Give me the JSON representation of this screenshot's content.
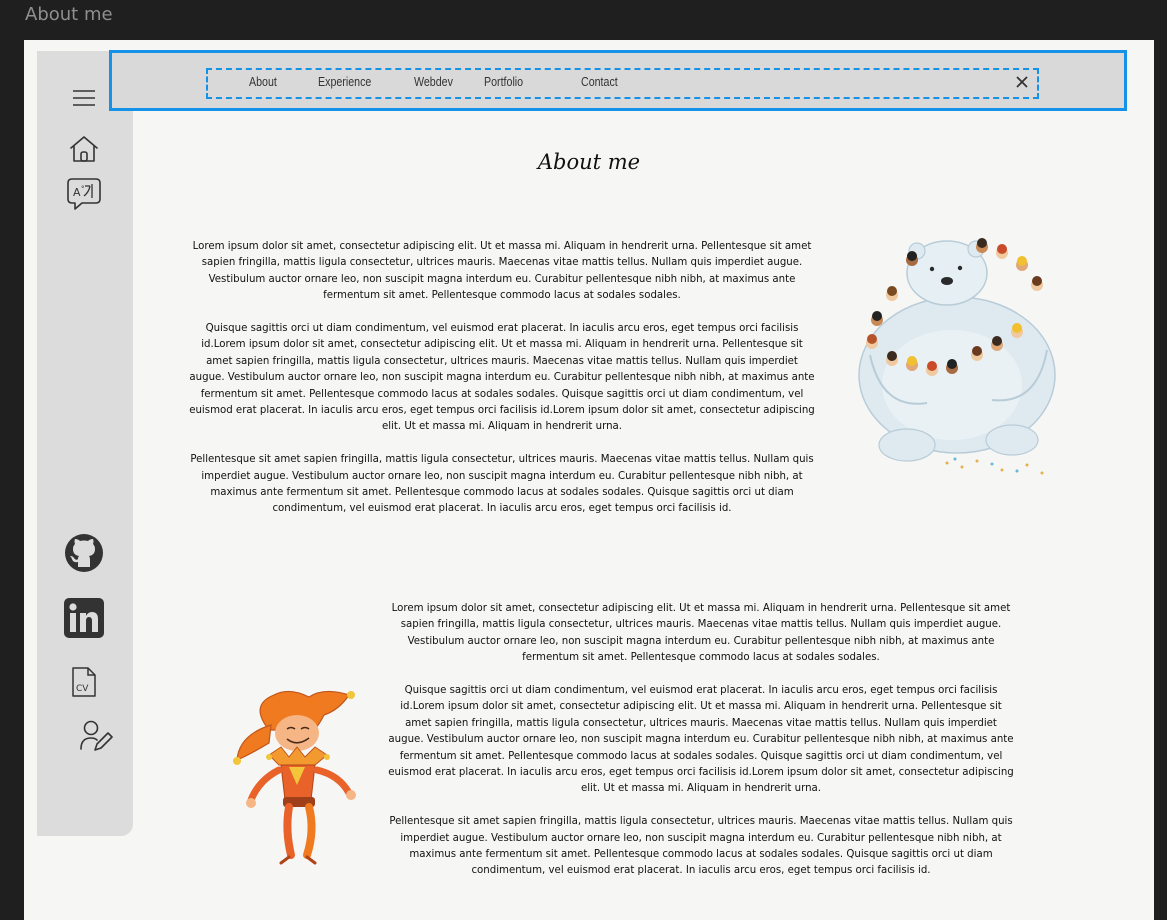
{
  "window": {
    "title": "About me"
  },
  "nav": {
    "items": [
      {
        "label": "About"
      },
      {
        "label": "Experience"
      },
      {
        "label": "Webdev"
      },
      {
        "label": "Portfolio"
      },
      {
        "label": "Contact"
      }
    ],
    "close_icon": "close-icon",
    "accent": "#1691e8"
  },
  "sidebar": {
    "icons": [
      "menu-icon",
      "home-icon",
      "language-icon",
      "github-icon",
      "linkedin-icon",
      "cv-document-icon",
      "user-edit-icon"
    ]
  },
  "main": {
    "title": "About me",
    "section1": {
      "paragraphs": [
        "Lorem ipsum dolor sit amet, consectetur adipiscing elit. Ut et massa mi. Aliquam in hendrerit urna. Pellentesque sit amet sapien fringilla, mattis ligula consectetur, ultrices mauris. Maecenas vitae mattis tellus. Nullam quis imperdiet augue. Vestibulum auctor ornare leo, non suscipit magna interdum eu. Curabitur pellentesque nibh nibh, at maximus ante fermentum sit amet. Pellentesque commodo lacus at sodales sodales.",
        "Quisque sagittis orci ut diam condimentum, vel euismod erat placerat. In iaculis arcu eros, eget tempus orci facilisis id.Lorem ipsum dolor sit amet, consectetur adipiscing elit. Ut et massa mi. Aliquam in hendrerit urna. Pellentesque sit amet sapien fringilla, mattis ligula consectetur, ultrices mauris. Maecenas vitae mattis tellus. Nullam quis imperdiet augue. Vestibulum auctor ornare leo, non suscipit magna interdum eu. Curabitur pellentesque nibh nibh, at maximus ante fermentum sit amet. Pellentesque commodo lacus at sodales sodales. Quisque sagittis orci ut diam condimentum, vel euismod erat placerat. In iaculis arcu eros, eget tempus orci facilisis id.Lorem ipsum dolor sit amet, consectetur adipiscing elit. Ut et massa mi. Aliquam in hendrerit urna.",
        "Pellentesque sit amet sapien fringilla, mattis ligula consectetur, ultrices mauris. Maecenas vitae mattis tellus. Nullam quis imperdiet augue. Vestibulum auctor ornare leo, non suscipit magna interdum eu. Curabitur pellentesque nibh nibh, at maximus ante fermentum sit amet. Pellentesque commodo lacus at sodales sodales. Quisque sagittis orci ut diam condimentum, vel euismod erat placerat. In iaculis arcu eros, eget tempus orci facilisis id."
      ],
      "illustration": "polar-bear-with-children-illustration"
    },
    "section2": {
      "paragraphs": [
        "Lorem ipsum dolor sit amet, consectetur adipiscing elit. Ut et massa mi. Aliquam in hendrerit urna. Pellentesque sit amet sapien fringilla, mattis ligula consectetur, ultrices mauris. Maecenas vitae mattis tellus. Nullam quis imperdiet augue. Vestibulum auctor ornare leo, non suscipit magna interdum eu. Curabitur pellentesque nibh nibh, at maximus ante fermentum sit amet. Pellentesque commodo lacus at sodales sodales.",
        "Quisque sagittis orci ut diam condimentum, vel euismod erat placerat. In iaculis arcu eros, eget tempus orci facilisis id.Lorem ipsum dolor sit amet, consectetur adipiscing elit. Ut et massa mi. Aliquam in hendrerit urna. Pellentesque sit amet sapien fringilla, mattis ligula consectetur, ultrices mauris. Maecenas vitae mattis tellus. Nullam quis imperdiet augue. Vestibulum auctor ornare leo, non suscipit magna interdum eu. Curabitur pellentesque nibh nibh, at maximus ante fermentum sit amet. Pellentesque commodo lacus at sodales sodales. Quisque sagittis orci ut diam condimentum, vel euismod erat placerat. In iaculis arcu eros, eget tempus orci facilisis id.Lorem ipsum dolor sit amet, consectetur adipiscing elit. Ut et massa mi. Aliquam in hendrerit urna.",
        "Pellentesque sit amet sapien fringilla, mattis ligula consectetur, ultrices mauris. Maecenas vitae mattis tellus. Nullam quis imperdiet augue. Vestibulum auctor ornare leo, non suscipit magna interdum eu. Curabitur pellentesque nibh nibh, at maximus ante fermentum sit amet. Pellentesque commodo lacus at sodales sodales. Quisque sagittis orci ut diam condimentum, vel euismod erat placerat. In iaculis arcu eros, eget tempus orci facilisis id."
      ],
      "illustration": "jester-illustration"
    }
  }
}
